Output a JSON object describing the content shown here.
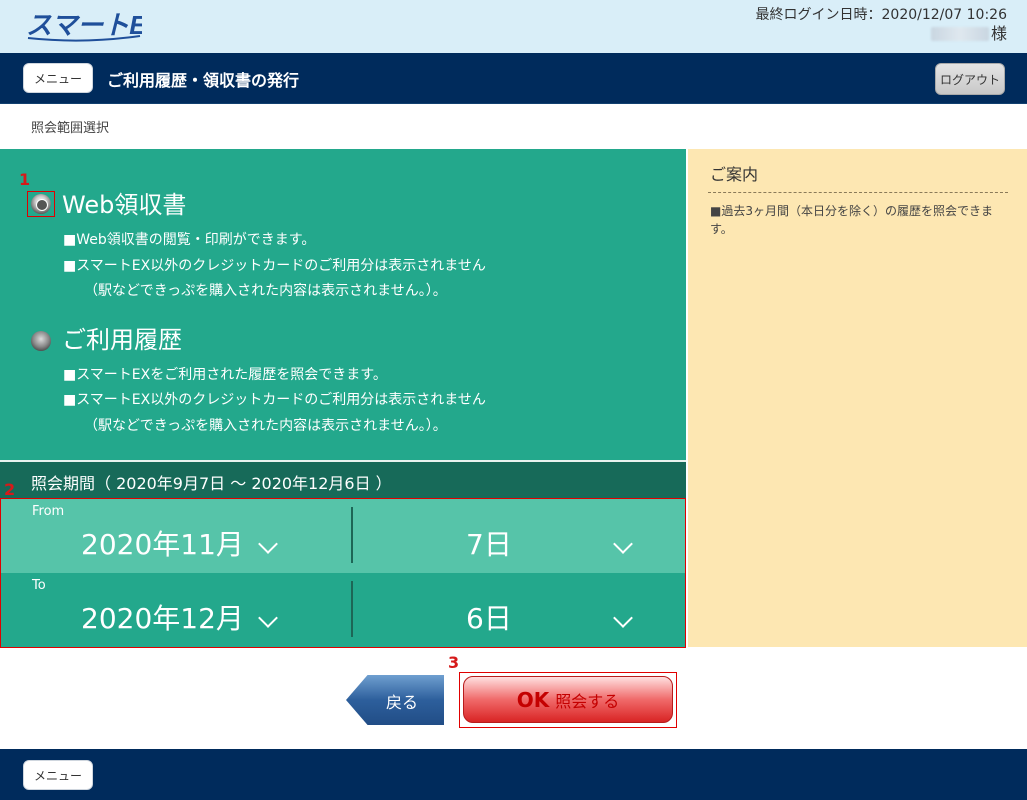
{
  "header": {
    "logo_text": "スマートEX",
    "last_login_label": "最終ログイン日時：2020/12/07 10:26",
    "user_suffix": "様"
  },
  "nav": {
    "menu_label": "メニュー",
    "title": "ご利用履歴・領収書の発行",
    "logout_label": "ログアウト"
  },
  "sub_title": "照会範囲選択",
  "options": [
    {
      "title": "Web領収書",
      "selected": true,
      "lines": [
        "■Web領収書の閲覧・印刷ができます。",
        "■スマートEX以外のクレジットカードのご利用分は表示されません",
        "（駅などできっぷを購入された内容は表示されません。）。"
      ]
    },
    {
      "title": "ご利用履歴",
      "selected": false,
      "lines": [
        "■スマートEXをご利用された履歴を照会できます。",
        "■スマートEX以外のクレジットカードのご利用分は表示されません",
        "（駅などできっぷを購入された内容は表示されません。）。"
      ]
    }
  ],
  "annotations": [
    "1",
    "2",
    "3"
  ],
  "period": {
    "label": "照会期間（ 2020年9月7日 ～ 2020年12月6日 ）"
  },
  "date_from": {
    "label": "From",
    "month": "2020年11月",
    "day": "7日"
  },
  "date_to": {
    "label": "To",
    "month": "2020年12月",
    "day": "6日"
  },
  "info": {
    "title": "ご案内",
    "text": "■過去3ヶ月間（本日分を除く）の履歴を照会できます。"
  },
  "buttons": {
    "back_label": "戻る",
    "ok_prefix": "OK",
    "ok_label": "照会する"
  },
  "footer": {
    "menu_label": "メニュー"
  },
  "colors": {
    "navy": "#002b5c",
    "teal": "#23a88c",
    "teal_light": "#56c4a9",
    "teal_dark": "#176a59",
    "info_bg": "#fde7b2",
    "header_bg": "#d9eef8",
    "annotation_red": "#e00000"
  }
}
